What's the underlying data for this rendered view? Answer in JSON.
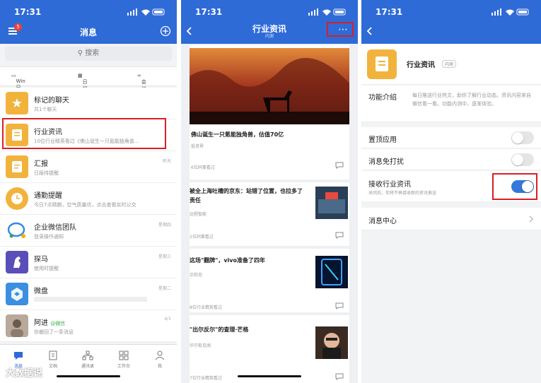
{
  "status": {
    "time": "17:31"
  },
  "p1": {
    "title": "消息",
    "menu_badge": "5",
    "search_placeholder": "搜索",
    "quick": [
      "Win已登录",
      "日程",
      "会议"
    ],
    "rows": [
      {
        "title": "标记的聊天",
        "sub": "共1个聊天",
        "time": "",
        "color": "#f2b33d"
      },
      {
        "title": "行业资讯",
        "sub": "10位行业精英看过《佛山诞生一只氪能独角兽...",
        "time": "",
        "color": "#f2b33d"
      },
      {
        "title": "汇报",
        "sub": "日报待提醒",
        "time": "昨天",
        "color": "#f2b33d"
      },
      {
        "title": "通勤提醒",
        "sub": "今日7点晴朗，空气质量优，点击查看实时公交",
        "time": "",
        "color": "#f2b33d"
      },
      {
        "title": "企业微信团队",
        "sub": "登录操作通知",
        "time": "星期四",
        "color": "#ffffff"
      },
      {
        "title": "探马",
        "sub": "使用时提醒",
        "time": "星期三",
        "color": "#5a4fb8"
      },
      {
        "title": "微盘",
        "sub": "",
        "time": "星期二",
        "color": "#3c8ee0"
      },
      {
        "title": "阿进",
        "wx": "@微信",
        "sub": "你撤回了一条消息",
        "time": "4/1",
        "color": "#b8a99a"
      }
    ],
    "tabs": [
      "消息",
      "文档",
      "通讯录",
      "工作台",
      "我"
    ]
  },
  "p2": {
    "title": "行业资讯",
    "subtitle": "内测",
    "articles": [
      {
        "title": "佛山诞生一只氪能独角兽，估值70亿",
        "source": "投资界",
        "views": "6位同事看过"
      },
      {
        "title": "被全上海吐槽的京东：站错了位置，也拉多了责任",
        "source": "远程智能",
        "views": "2位同事看过"
      },
      {
        "title": "这场\"翻牌\"，vivo准备了四年",
        "source": "正和岛",
        "views": "8位行业精英看过"
      },
      {
        "title": "\"出尔反尔\"的查理·芒格",
        "source": "华尔街见闻",
        "views": "7位行业精英看过"
      }
    ]
  },
  "p3": {
    "app_name": "行业资讯",
    "app_badge": "内测",
    "intro_label": "功能介绍",
    "intro_text": "每日推送行业热文，助你了解行业动态。资讯内容来自微信看一看。功能内测中，逐渐体验。",
    "pin_label": "置顶应用",
    "mute_label": "消息免打扰",
    "receive_label": "接收行业资讯",
    "receive_sub": "关闭后，你将不再接收新的资讯推送",
    "center_label": "消息中心",
    "pin_on": false,
    "mute_on": false,
    "receive_on": true
  },
  "watermark": "大数据说",
  "colors": {
    "brand": "#2f6bd7",
    "highlight": "#d81f26",
    "toggle_on": "#3479d9"
  }
}
